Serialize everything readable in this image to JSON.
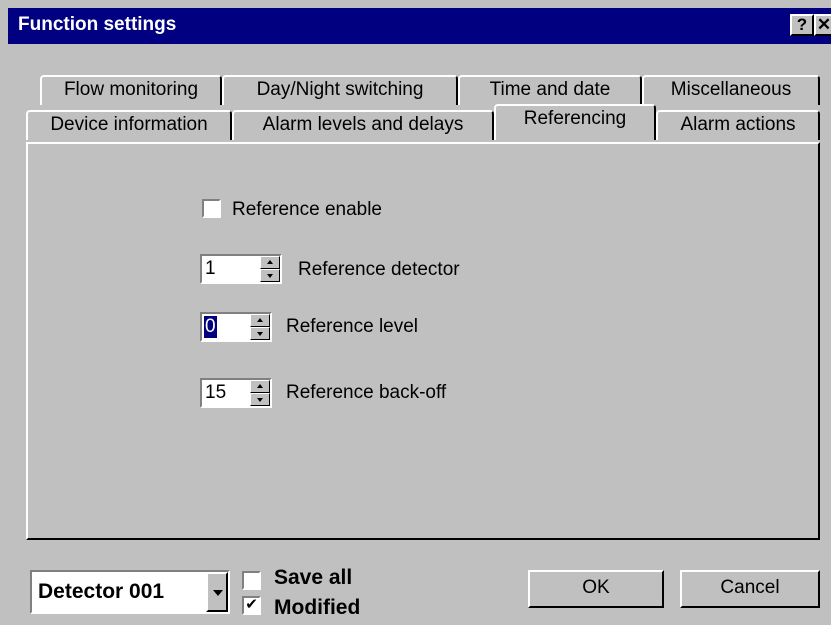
{
  "window": {
    "title": "Function settings",
    "help_label": "?",
    "close_label": "✕"
  },
  "tabs": {
    "row1": [
      {
        "label": "Flow monitoring"
      },
      {
        "label": "Day/Night switching"
      },
      {
        "label": "Time and date"
      },
      {
        "label": "Miscellaneous"
      }
    ],
    "row2": [
      {
        "label": "Device information"
      },
      {
        "label": "Alarm levels and delays"
      },
      {
        "label": "Referencing",
        "active": true
      },
      {
        "label": "Alarm actions"
      }
    ]
  },
  "referencing": {
    "enable_label": "Reference enable",
    "enable_checked": false,
    "detector_label": "Reference detector",
    "detector_value": "1",
    "level_label": "Reference level",
    "level_value": "0",
    "backoff_label": "Reference back-off",
    "backoff_value": "15"
  },
  "footer": {
    "detector_select": "Detector 001",
    "save_all_label": "Save all",
    "save_all_checked": false,
    "modified_label": "Modified",
    "modified_checked": true,
    "ok_label": "OK",
    "cancel_label": "Cancel"
  }
}
